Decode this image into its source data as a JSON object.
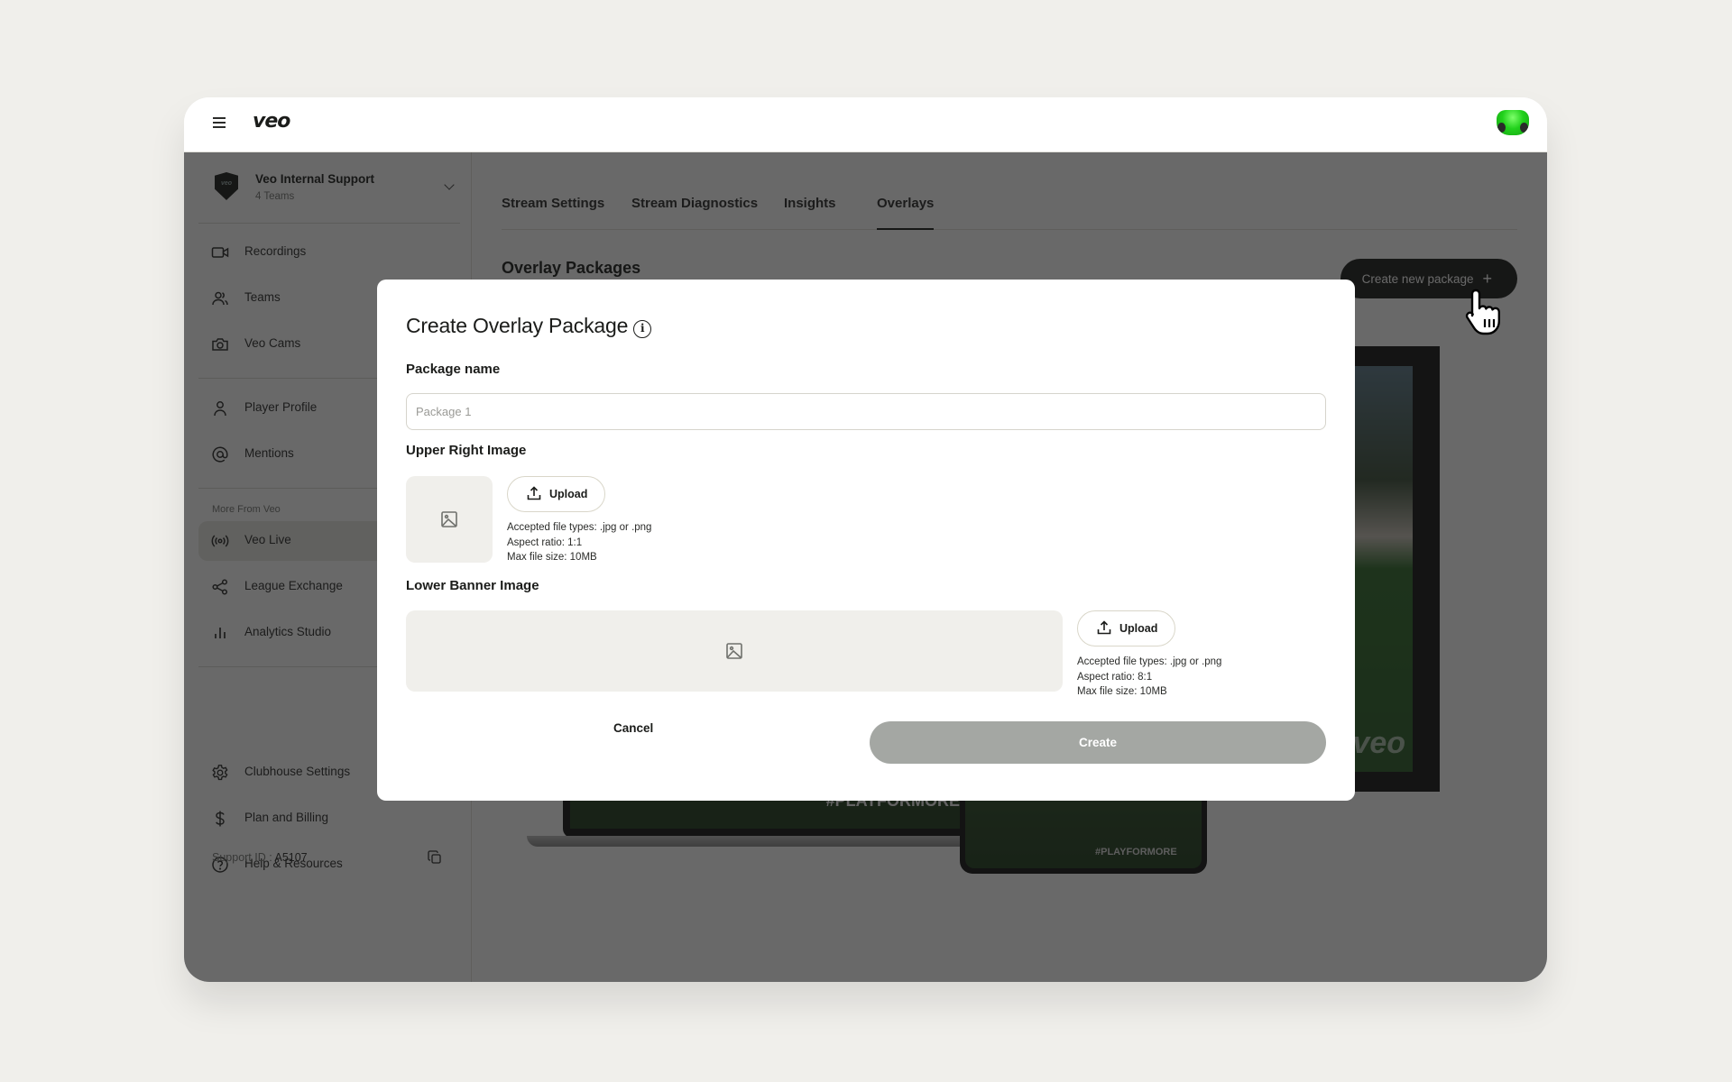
{
  "topbar": {
    "logo": "veo",
    "avatar": "user-avatar"
  },
  "sidebar": {
    "team": {
      "name": "Veo Internal Support",
      "subtitle": "4 Teams",
      "badge": "veo"
    },
    "items_primary": [
      {
        "label": "Recordings",
        "icon": "video-camera-icon"
      },
      {
        "label": "Teams",
        "icon": "users-icon"
      },
      {
        "label": "Veo Cams",
        "icon": "camera-icon"
      }
    ],
    "items_profile": [
      {
        "label": "Player Profile",
        "icon": "user-icon"
      },
      {
        "label": "Mentions",
        "icon": "at-sign-icon"
      }
    ],
    "more_label": "More From Veo",
    "items_more": [
      {
        "label": "Veo Live",
        "icon": "broadcast-icon",
        "active": true
      },
      {
        "label": "League Exchange",
        "icon": "share-icon"
      },
      {
        "label": "Analytics Studio",
        "icon": "bar-chart-icon"
      }
    ],
    "items_bottom": [
      {
        "label": "Clubhouse Settings",
        "icon": "gear-icon"
      },
      {
        "label": "Plan and Billing",
        "icon": "dollar-icon"
      },
      {
        "label": "Help & Resources",
        "icon": "help-circle-icon"
      }
    ],
    "support_label": "Support ID : ",
    "support_id": "A5107"
  },
  "main": {
    "tabs": [
      {
        "label": "Stream Settings",
        "active": false
      },
      {
        "label": "Stream Diagnostics",
        "active": false
      },
      {
        "label": "Insights",
        "active": false
      },
      {
        "label": "Overlays",
        "active": true
      }
    ],
    "section_title": "Overlay Packages",
    "create_new_label": "Create new package",
    "preview": {
      "hashtag": "#PLAYFORMORE",
      "watermark": "veo"
    }
  },
  "modal": {
    "title": "Create Overlay Package",
    "package_name_label": "Package name",
    "package_name_value": "",
    "package_name_placeholder": "Package 1",
    "upper_right": {
      "label": "Upper Right Image",
      "upload_label": "Upload",
      "hint_types": "Accepted file types: .jpg or .png",
      "hint_ratio": "Aspect ratio: 1:1",
      "hint_size": "Max file size: 10MB"
    },
    "lower_banner": {
      "label": "Lower Banner Image",
      "upload_label": "Upload",
      "hint_types": "Accepted file types: .jpg or .png",
      "hint_ratio": "Aspect ratio: 8:1",
      "hint_size": "Max file size: 10MB"
    },
    "cancel_label": "Cancel",
    "create_label": "Create"
  },
  "colors": {
    "background": "#f0efeb",
    "primary_dark": "#1b1c1a",
    "disabled_button": "#a4a7a3",
    "dropzone": "#f0efeb",
    "avatar_green": "#22d11c"
  }
}
